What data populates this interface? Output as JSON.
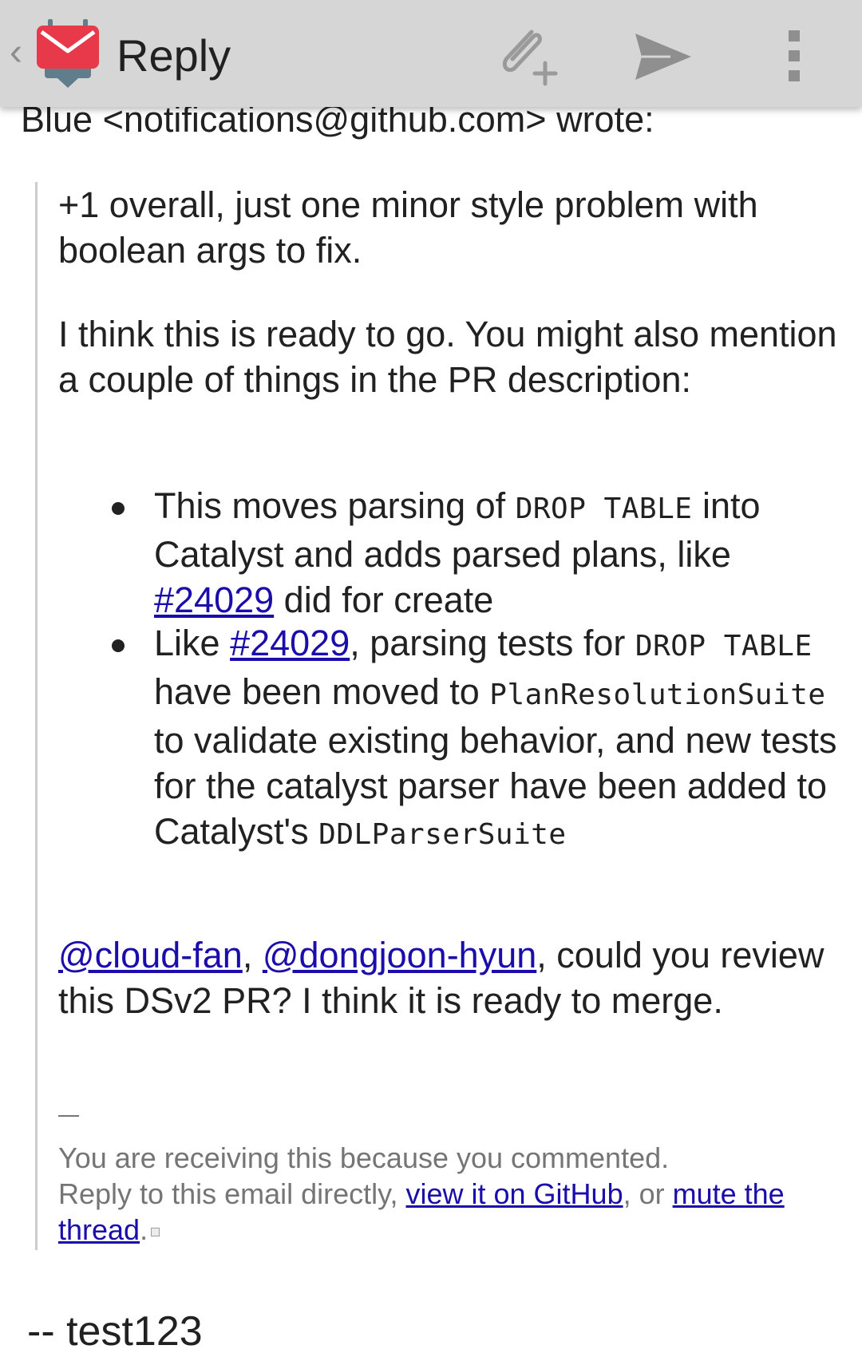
{
  "header": {
    "title": "Reply"
  },
  "email": {
    "attribution": "Blue <notifications@github.com> wrote:",
    "p1": "+1 overall, just one minor style problem with boolean args to fix.",
    "p2": "I think this is ready to go. You might also mention a couple of things in the PR description:",
    "bullet1": {
      "t1": "This moves parsing of ",
      "code1": "DROP TABLE",
      "t2": " into Catalyst and adds parsed plans, like ",
      "link": "#24029",
      "t3": " did for create"
    },
    "bullet2": {
      "t1": "Like ",
      "link": "#24029",
      "t2": ", parsing tests for ",
      "code1": "DROP TABLE",
      "t3": " have been moved to ",
      "code2": "PlanResolutionSuite",
      "t4": " to validate existing behavior, and new tests for the catalyst parser have been added to Catalyst's ",
      "code3": "DDLParserSuite"
    },
    "p3": {
      "mention1": "@cloud-fan",
      "sep": ", ",
      "mention2": "@dongjoon-hyun",
      "t1": ", could you review this DSv2 PR? I think it is ready to merge."
    },
    "footer": {
      "dash": "—",
      "line1": "You are receiving this because you commented.",
      "t1": "Reply to this email directly, ",
      "link1": "view it on GitHub",
      "t2": ", or ",
      "link2": "mute the thread",
      "t3": "."
    },
    "signature": "-- test123"
  },
  "icons": {
    "app": "k9-mail-logo-icon",
    "attach": "attach-add-icon",
    "send": "send-icon",
    "overflow": "overflow-menu-icon"
  },
  "colors": {
    "action_bar": "#d6d6d6",
    "link": "#1a0dab",
    "footer_text": "#757575",
    "logo_red": "#e8394a"
  }
}
